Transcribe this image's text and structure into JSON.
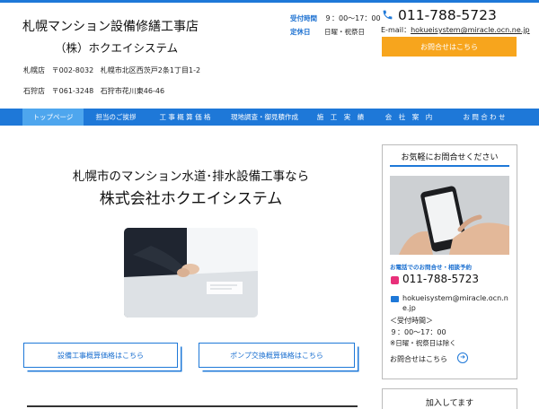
{
  "header": {
    "site_title": "札幌マンション設備修繕工事店",
    "company": "（株）ホクエイシステム",
    "branches": [
      {
        "name": "札幌店",
        "zip": "〒002-8032",
        "address": "札幌市北区西茨戸2条1丁目1-2"
      },
      {
        "name": "石狩店",
        "zip": "〒061-3248",
        "address": "石狩市花川東46-46"
      }
    ],
    "hours_label": "受付時間",
    "hours_value": "９：00～17：00",
    "closed_label": "定休日",
    "closed_value": "日曜・祝祭日",
    "phone": "011-788-5723",
    "email_prefix": "E-mail：",
    "email": "hokueisystem@miracle.ocn.ne.jp",
    "contact_button": "お問合せはこちら"
  },
  "nav": {
    "items": [
      {
        "label": "トップページ",
        "active": true
      },
      {
        "label": "担当のご挨拶",
        "active": false
      },
      {
        "label": "工 事 概 算 価 格",
        "active": false
      },
      {
        "label": "現地調査・御見積作成",
        "active": false
      },
      {
        "label": "施　工　実　績",
        "active": false
      },
      {
        "label": "会　社　案　内",
        "active": false
      },
      {
        "label": "お 問 合 わ せ",
        "active": false
      }
    ]
  },
  "hero": {
    "line1": "札幌市のマンション水道･排水設備工事なら",
    "line2": "株式会社ホクエイシステム"
  },
  "cta": {
    "equipment": "設備工事概算価格はこちら",
    "pump": "ポンプ交換概算価格はこちら"
  },
  "sidebar": {
    "title": "お気軽にお問合せください",
    "phone_label": "お電話でのお問合せ・相談予約",
    "phone": "011-788-5723",
    "email": "hokueisystem@miracle.ocn.ne.jp",
    "hours_title": "＜受付時間＞",
    "hours": "９：00～17：00",
    "closed": "※日曜・祝祭日は除く",
    "inquiry_link": "お問合せはこちら",
    "second_box_title": "加入してます"
  },
  "colors": {
    "accent": "#1e78d8",
    "nav_active": "#4ea6ee",
    "button_orange": "#f7a51d",
    "phone_icon_pink": "#e8307a"
  }
}
